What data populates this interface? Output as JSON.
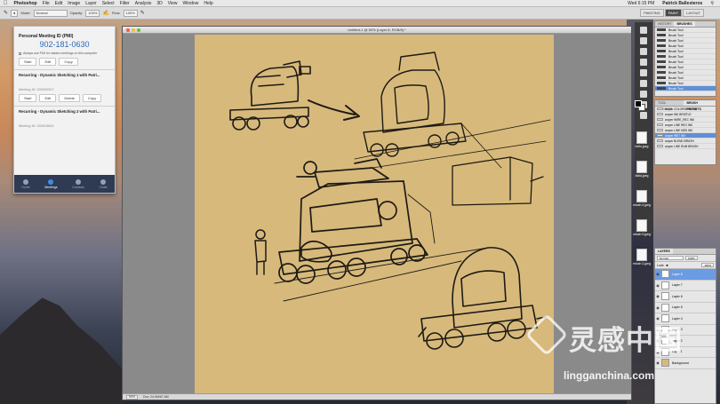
{
  "menubar": {
    "app": "Photoshop",
    "items": [
      "File",
      "Edit",
      "Image",
      "Layer",
      "Select",
      "Filter",
      "Analysis",
      "3D",
      "View",
      "Window",
      "Help"
    ],
    "clock": "Wed 6:15 PM",
    "user": "Patrick Ballesteros"
  },
  "options": {
    "mode_label": "Mode:",
    "mode_value": "Normal",
    "opacity_label": "Opacity:",
    "opacity_value": "100%",
    "flow_label": "Flow:",
    "flow_value": "100%",
    "workspace_tabs": [
      "PAINTING",
      "PAINT",
      "LAYOUT"
    ],
    "workspace_active": "PAINT"
  },
  "zoom": {
    "pmi_label": "Personal Meeting ID (PMI)",
    "pmi_number": "902-181-0630",
    "pmi_checkbox": "Always use PMI for instant meetings on this computer",
    "start": "Start",
    "edit": "Edit",
    "copy": "Copy",
    "delete": "Delete",
    "meetings": [
      {
        "title": "Recurring - Dynamic Sketching 1 with Patri...",
        "id": "Meeting ID: 000000007"
      },
      {
        "title": "Recurring - Dynamic Sketching 2 with Patri...",
        "id": "Meeting ID: 000013643"
      }
    ],
    "nav": [
      "Home",
      "Meetings",
      "Contacts",
      "Chats"
    ],
    "nav_active": "Meetings"
  },
  "document": {
    "title": "Untitled-1 @ 50% (Layer 8, RGB/8) *",
    "status_zoom": "50%",
    "status_doc": "Doc: 24.9M/67.6M"
  },
  "files": [
    "bello.jpeg",
    "dlala.jpeg",
    "micah 4.jpeg",
    "micah 3.jpeg",
    "micah 2.jpeg"
  ],
  "brushes": {
    "tab": "BRUSHES",
    "tab2": "HISTORY",
    "items": [
      "Brush Tool",
      "Brush Tool",
      "Brush Tool",
      "Brush Tool",
      "Brush Tool",
      "Brush Tool",
      "Brush Tool",
      "Brush Tool",
      "Brush Tool",
      "Brush Tool",
      "Brush Tool",
      "Brush Tool"
    ]
  },
  "presets": {
    "tab": "TOOL PRESETS",
    "tab2": "BRUSH PRESETS",
    "items": [
      "aroper COLORSKIN PEN",
      "aroper INK BRISTLE",
      "aroper WIRE_REC INK",
      "aroper LINE REG INK",
      "aroper LINE MED INK",
      "aroper WET INK",
      "aroper BLEND BRUSH",
      "aroper LINE RUM BRUSH"
    ],
    "selected": 5
  },
  "layers": {
    "tab": "LAYERS",
    "blend": "Normal",
    "opacity": "100%",
    "fill": "100%",
    "lock_label": "Lock:",
    "items": [
      "Layer 8",
      "Layer 7",
      "Layer 6",
      "Layer 5",
      "Layer 4",
      "Layer 3",
      "Layer 2",
      "Layer 1",
      "Background"
    ],
    "selected": 0
  },
  "watermark": {
    "cn": "灵感中国",
    "url": "lingganchina.com"
  },
  "colors": {
    "canvas": "#d7b97b",
    "selection": "#6b9be3",
    "zoom_accent": "#2d6ab4"
  }
}
